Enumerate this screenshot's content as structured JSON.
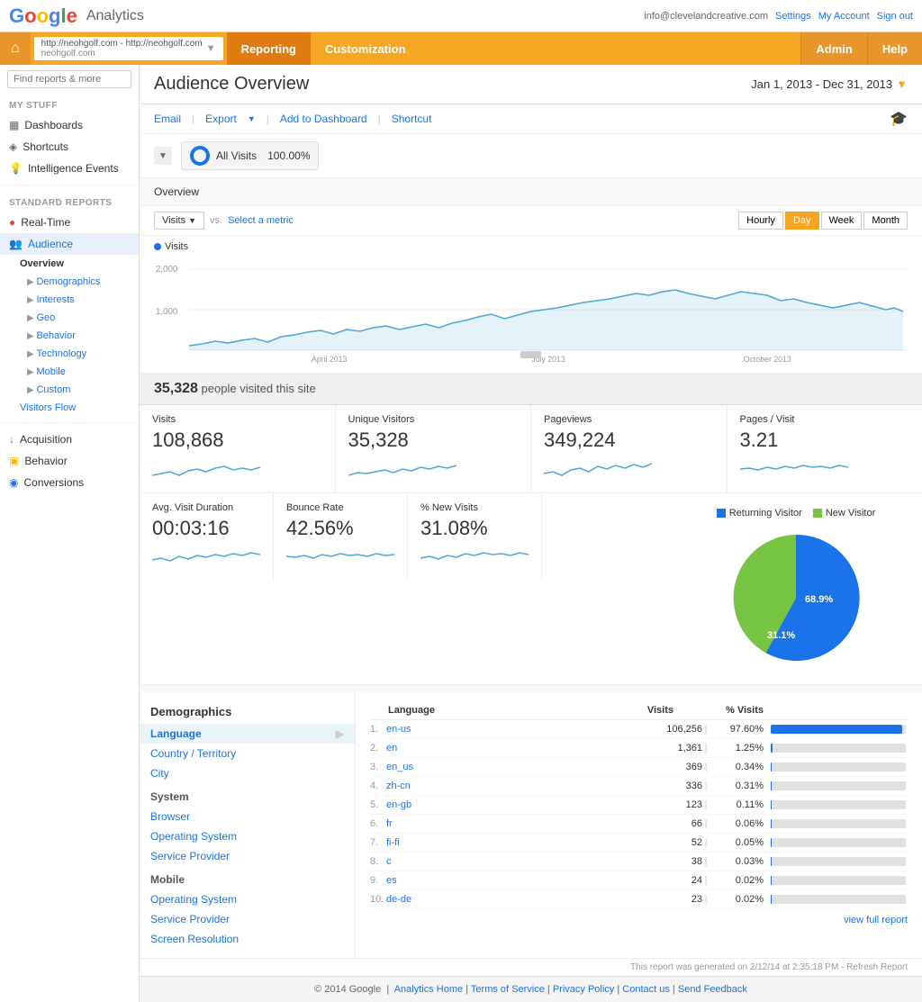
{
  "topbar": {
    "logo": "Google",
    "product": "Analytics",
    "user_email": "info@clevelandcreative.com",
    "settings_label": "Settings",
    "account_label": "My Account",
    "signout_label": "Sign out"
  },
  "navbar": {
    "home_icon": "⌂",
    "url_line1": "http://neohgolf.com - http://neohgolf.com",
    "url_line2": "neohgolf.com",
    "reporting_label": "Reporting",
    "customization_label": "Customization",
    "admin_label": "Admin",
    "help_label": "Help"
  },
  "sidebar": {
    "search_placeholder": "Find reports & more",
    "my_stuff_label": "MY STUFF",
    "dashboards_label": "Dashboards",
    "shortcuts_label": "Shortcuts",
    "intelligence_label": "Intelligence Events",
    "standard_reports_label": "STANDARD REPORTS",
    "realtime_label": "Real-Time",
    "audience_label": "Audience",
    "overview_label": "Overview",
    "demographics_label": "Demographics",
    "interests_label": "Interests",
    "geo_label": "Geo",
    "behavior_label": "Behavior",
    "technology_label": "Technology",
    "mobile_label": "Mobile",
    "custom_label": "Custom",
    "visitors_flow_label": "Visitors Flow",
    "acquisition_label": "Acquisition",
    "behavior2_label": "Behavior",
    "conversions_label": "Conversions"
  },
  "page": {
    "title": "Audience Overview",
    "date_range": "Jan 1, 2013 - Dec 31, 2013",
    "toolbar": {
      "email_label": "Email",
      "export_label": "Export",
      "add_dashboard_label": "Add to Dashboard",
      "shortcut_label": "Shortcut"
    },
    "segment": {
      "label": "All Visits",
      "pct": "100.00%"
    },
    "overview_label": "Overview",
    "chart": {
      "metric_label": "Visits",
      "vs_label": "vs.",
      "select_metric_label": "Select a metric",
      "visits_legend": "Visits",
      "y_labels": [
        "2,000",
        "1,000"
      ],
      "x_labels": [
        "April 2013",
        "July 2013",
        "October 2013"
      ],
      "period_buttons": [
        "Hourly",
        "Day",
        "Week",
        "Month"
      ],
      "active_period": "Day"
    },
    "summary": {
      "text": "35,328 people visited this site"
    },
    "stats": [
      {
        "label": "Visits",
        "value": "108,868"
      },
      {
        "label": "Unique Visitors",
        "value": "35,328"
      },
      {
        "label": "Pageviews",
        "value": "349,224"
      },
      {
        "label": "Pages / Visit",
        "value": "3.21"
      },
      {
        "label": "Avg. Visit Duration",
        "value": "00:03:16"
      },
      {
        "label": "Bounce Rate",
        "value": "42.56%"
      },
      {
        "label": "% New Visits",
        "value": "31.08%"
      }
    ],
    "pie": {
      "returning_label": "Returning Visitor",
      "returning_pct": 68.9,
      "new_label": "New Visitor",
      "new_pct": 31.1,
      "returning_color": "#1a73e8",
      "new_color": "#76c442",
      "returning_display": "68.9%",
      "new_display": "31.1%"
    },
    "demographics": {
      "title": "Demographics",
      "left_links": [
        {
          "label": "Language",
          "active": true
        },
        {
          "label": "Country / Territory"
        },
        {
          "label": "City"
        }
      ],
      "system_label": "System",
      "system_links": [
        {
          "label": "Browser"
        },
        {
          "label": "Operating System"
        },
        {
          "label": "Service Provider"
        }
      ],
      "mobile_label": "Mobile",
      "mobile_links": [
        {
          "label": "Operating System"
        },
        {
          "label": "Service Provider"
        },
        {
          "label": "Screen Resolution"
        }
      ],
      "table": {
        "section_label": "Language",
        "col_visits": "Visits",
        "col_pct": "% Visits",
        "rows": [
          {
            "rank": "1.",
            "lang": "en-us",
            "visits": "106,256",
            "pct": "97.60%",
            "bar_pct": 97.6
          },
          {
            "rank": "2.",
            "lang": "en",
            "visits": "1,361",
            "pct": "1.25%",
            "bar_pct": 1.25
          },
          {
            "rank": "3.",
            "lang": "en_us",
            "visits": "369",
            "pct": "0.34%",
            "bar_pct": 0.34
          },
          {
            "rank": "4.",
            "lang": "zh-cn",
            "visits": "336",
            "pct": "0.31%",
            "bar_pct": 0.31
          },
          {
            "rank": "5.",
            "lang": "en-gb",
            "visits": "123",
            "pct": "0.11%",
            "bar_pct": 0.11
          },
          {
            "rank": "6.",
            "lang": "fr",
            "visits": "66",
            "pct": "0.06%",
            "bar_pct": 0.06
          },
          {
            "rank": "7.",
            "lang": "fi-fi",
            "visits": "52",
            "pct": "0.05%",
            "bar_pct": 0.05
          },
          {
            "rank": "8.",
            "lang": "c",
            "visits": "38",
            "pct": "0.03%",
            "bar_pct": 0.03
          },
          {
            "rank": "9.",
            "lang": "es",
            "visits": "24",
            "pct": "0.02%",
            "bar_pct": 0.02
          },
          {
            "rank": "10.",
            "lang": "de-de",
            "visits": "23",
            "pct": "0.02%",
            "bar_pct": 0.02
          }
        ],
        "view_full_label": "view full report"
      }
    },
    "report_footer": "This report was generated on 2/12/14 at 2:35:18 PM - Refresh Report",
    "site_footer": {
      "copyright": "© 2014 Google",
      "links": [
        "Analytics Home",
        "Terms of Service",
        "Privacy Policy",
        "Contact us",
        "Send Feedback"
      ]
    }
  }
}
